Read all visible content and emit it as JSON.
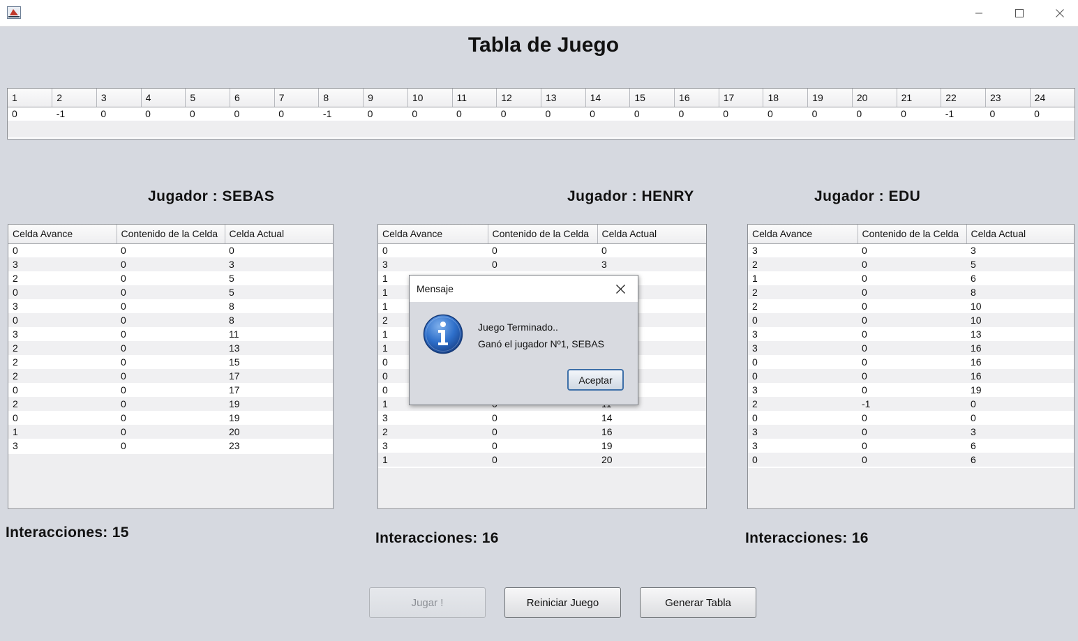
{
  "window": {
    "title": "",
    "icon": "java-app-icon"
  },
  "header": {
    "title": "Tabla de Juego"
  },
  "board": {
    "headers": [
      "1",
      "2",
      "3",
      "4",
      "5",
      "6",
      "7",
      "8",
      "9",
      "10",
      "11",
      "12",
      "13",
      "14",
      "15",
      "16",
      "17",
      "18",
      "19",
      "20",
      "21",
      "22",
      "23",
      "24"
    ],
    "values": [
      "0",
      "-1",
      "0",
      "0",
      "0",
      "0",
      "0",
      "-1",
      "0",
      "0",
      "0",
      "0",
      "0",
      "0",
      "0",
      "0",
      "0",
      "0",
      "0",
      "0",
      "0",
      "-1",
      "0",
      "0"
    ]
  },
  "columns": [
    "Celda Avance",
    "Contenido de la Celda",
    "Celda Actual"
  ],
  "players": [
    {
      "title": "Jugador : SEBAS",
      "interactions": "Interacciones: 15",
      "rows": [
        [
          "0",
          "0",
          "0"
        ],
        [
          "3",
          "0",
          "3"
        ],
        [
          "2",
          "0",
          "5"
        ],
        [
          "0",
          "0",
          "5"
        ],
        [
          "3",
          "0",
          "8"
        ],
        [
          "0",
          "0",
          "8"
        ],
        [
          "3",
          "0",
          "11"
        ],
        [
          "2",
          "0",
          "13"
        ],
        [
          "2",
          "0",
          "15"
        ],
        [
          "2",
          "0",
          "17"
        ],
        [
          "0",
          "0",
          "17"
        ],
        [
          "2",
          "0",
          "19"
        ],
        [
          "0",
          "0",
          "19"
        ],
        [
          "1",
          "0",
          "20"
        ],
        [
          "3",
          "0",
          "23"
        ]
      ]
    },
    {
      "title": "Jugador : HENRY",
      "interactions": "Interacciones: 16",
      "rows": [
        [
          "0",
          "0",
          "0"
        ],
        [
          "3",
          "0",
          "3"
        ],
        [
          "1",
          "",
          ""
        ],
        [
          "1",
          "",
          ""
        ],
        [
          "1",
          "",
          ""
        ],
        [
          "2",
          "",
          ""
        ],
        [
          "1",
          "",
          ""
        ],
        [
          "1",
          "",
          ""
        ],
        [
          "0",
          "",
          ""
        ],
        [
          "0",
          "",
          ""
        ],
        [
          "0",
          "",
          ""
        ],
        [
          "1",
          "0",
          "11"
        ],
        [
          "3",
          "0",
          "14"
        ],
        [
          "2",
          "0",
          "16"
        ],
        [
          "3",
          "0",
          "19"
        ],
        [
          "1",
          "0",
          "20"
        ]
      ]
    },
    {
      "title": "Jugador : EDU",
      "interactions": "Interacciones: 16",
      "rows": [
        [
          "3",
          "0",
          "3"
        ],
        [
          "2",
          "0",
          "5"
        ],
        [
          "1",
          "0",
          "6"
        ],
        [
          "2",
          "0",
          "8"
        ],
        [
          "2",
          "0",
          "10"
        ],
        [
          "0",
          "0",
          "10"
        ],
        [
          "3",
          "0",
          "13"
        ],
        [
          "3",
          "0",
          "16"
        ],
        [
          "0",
          "0",
          "16"
        ],
        [
          "0",
          "0",
          "16"
        ],
        [
          "3",
          "0",
          "19"
        ],
        [
          "2",
          "-1",
          "0"
        ],
        [
          "0",
          "0",
          "0"
        ],
        [
          "3",
          "0",
          "3"
        ],
        [
          "3",
          "0",
          "6"
        ],
        [
          "0",
          "0",
          "6"
        ]
      ]
    }
  ],
  "buttons": {
    "play": "Jugar !",
    "restart": "Reiniciar Juego",
    "generate": "Generar Tabla"
  },
  "dialog": {
    "title": "Mensaje",
    "line1": "Juego Terminado..",
    "line2": "Ganó el jugador Nº1, SEBAS",
    "ok": "Aceptar",
    "icon": "information-icon"
  }
}
